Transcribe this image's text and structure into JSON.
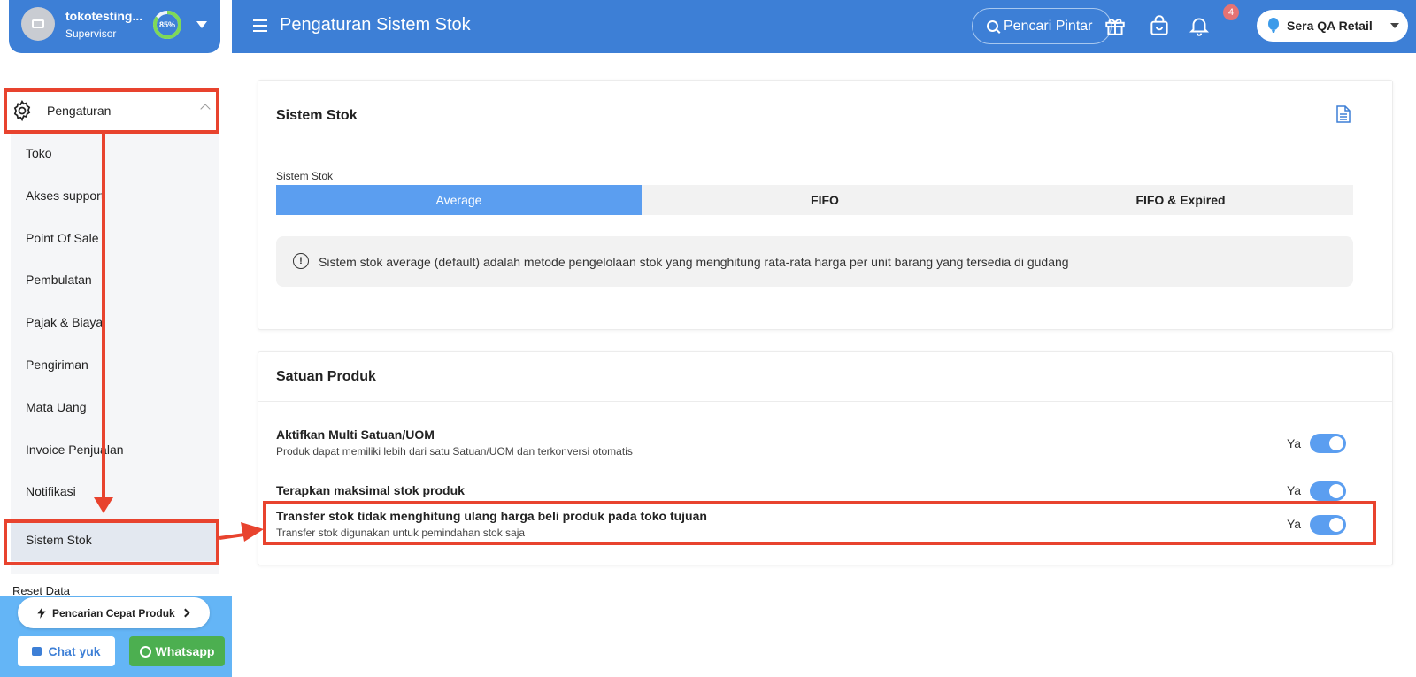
{
  "profile": {
    "name": "tokotesting...",
    "role": "Supervisor",
    "progress_text": "85%",
    "progress_fraction": 0.85
  },
  "sidebar": {
    "parent_label": "Pengaturan",
    "items": [
      {
        "label": "Toko"
      },
      {
        "label": "Akses support"
      },
      {
        "label": "Point Of Sale"
      },
      {
        "label": "Pembulatan"
      },
      {
        "label": "Pajak & Biaya"
      },
      {
        "label": "Pengiriman"
      },
      {
        "label": "Mata Uang"
      },
      {
        "label": "Invoice Penjualan"
      },
      {
        "label": "Notifikasi"
      },
      {
        "label": "Sistem Stok"
      }
    ],
    "active_item": "Sistem Stok",
    "partial_item": "Reset Data"
  },
  "bottom": {
    "quick_search": "Pencarian Cepat Produk",
    "chat": "Chat yuk",
    "whatsapp": "Whatsapp"
  },
  "header": {
    "title": "Pengaturan Sistem Stok",
    "smart_search": "Pencari Pintar",
    "notification_count": "4",
    "store_name": "Sera QA Retail"
  },
  "stock_card": {
    "title": "Sistem Stok",
    "field_label": "Sistem Stok",
    "options": [
      {
        "label": "Average",
        "active": true
      },
      {
        "label": "FIFO",
        "active": false
      },
      {
        "label": "FIFO & Expired",
        "active": false
      }
    ],
    "info": "Sistem stok average (default) adalah metode pengelolaan stok yang menghitung rata-rata harga per unit barang yang tersedia di gudang"
  },
  "unit_card": {
    "title": "Satuan Produk",
    "settings": [
      {
        "title": "Aktifkan Multi Satuan/UOM",
        "desc": "Produk dapat memiliki lebih dari satu Satuan/UOM dan terkonversi otomatis",
        "value": "Ya",
        "on": true
      },
      {
        "title": "Terapkan maksimal stok produk",
        "desc": "",
        "value": "Ya",
        "on": true
      },
      {
        "title": "Transfer stok tidak menghitung ulang harga beli produk pada toko tujuan",
        "desc": "Transfer stok digunakan untuk pemindahan stok saja",
        "value": "Ya",
        "on": true
      }
    ]
  },
  "colors": {
    "primary": "#3d7fd6",
    "segment_active": "#5b9ef0",
    "annotation": "#e8432e",
    "whatsapp": "#4caf50"
  }
}
